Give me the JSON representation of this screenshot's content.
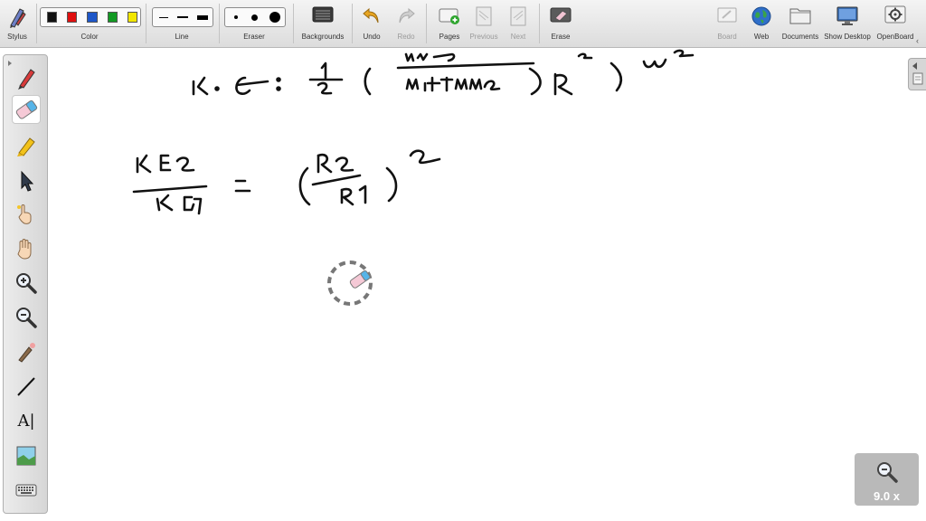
{
  "toolbar": {
    "stylus_label": "Stylus",
    "color_label": "Color",
    "line_label": "Line",
    "eraser_label": "Eraser",
    "backgrounds_label": "Backgrounds",
    "undo_label": "Undo",
    "redo_label": "Redo",
    "pages_label": "Pages",
    "previous_label": "Previous",
    "next_label": "Next",
    "erase_label": "Erase",
    "board_label": "Board",
    "web_label": "Web",
    "documents_label": "Documents",
    "show_desktop_label": "Show Desktop",
    "openboard_label": "OpenBoard",
    "colors": [
      "#111111",
      "#e01010",
      "#1e57c8",
      "#139a24",
      "#f2e600"
    ]
  },
  "left_tools": [
    "pen-icon",
    "eraser-icon",
    "marker-icon",
    "selector-icon",
    "interact-hand-icon",
    "pan-hand-icon",
    "zoom-in-icon",
    "zoom-out-icon",
    "laser-pointer-icon",
    "line-icon",
    "text-icon",
    "capture-icon",
    "keyboard-icon"
  ],
  "zoom": {
    "label": "9.0 x"
  }
}
